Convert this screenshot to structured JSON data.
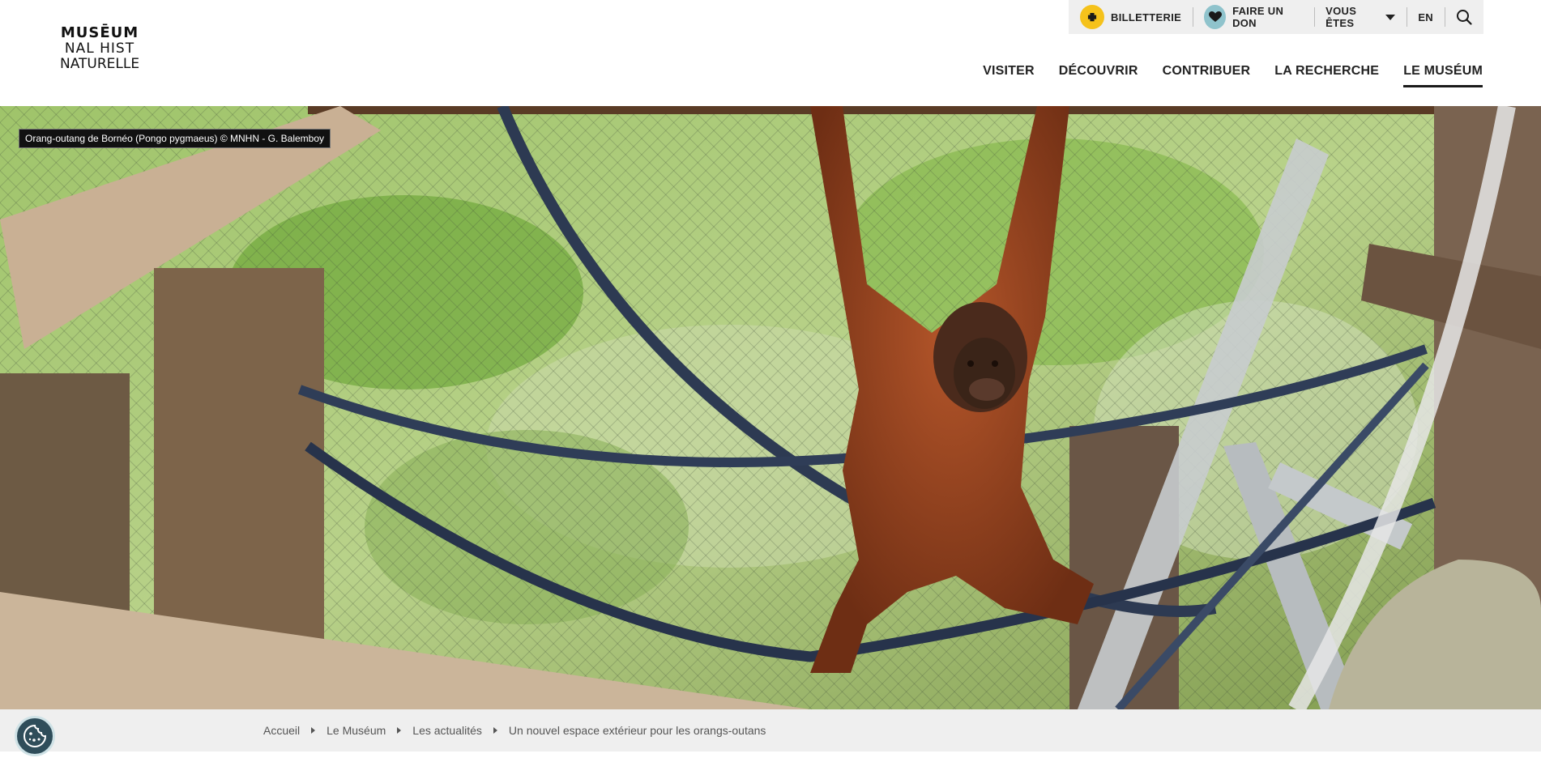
{
  "logo": {
    "line1": "MUSĒUM",
    "line2": "NAL HIST",
    "line3": "NATURELLE"
  },
  "topbar": {
    "ticket_label": "BILLETTERIE",
    "donate_label": "FAIRE UN DON",
    "profile_label": "VOUS ÊTES",
    "lang_label": "EN"
  },
  "nav": {
    "items": [
      {
        "label": "VISITER"
      },
      {
        "label": "DÉCOUVRIR"
      },
      {
        "label": "CONTRIBUER"
      },
      {
        "label": "LA RECHERCHE"
      },
      {
        "label": "LE MUSÉUM"
      }
    ],
    "active_index": 4
  },
  "hero": {
    "credit": "Orang-outang de Bornéo (Pongo pygmaeus) © MNHN - G. Balemboy"
  },
  "breadcrumb": {
    "items": [
      "Accueil",
      "Le Muséum",
      "Les actualités"
    ],
    "current": "Un nouvel espace extérieur pour les orangs-outans"
  },
  "colors": {
    "ticket_icon_bg": "#f5c21b",
    "donate_icon_bg": "#8fc3cc",
    "topbar_bg": "#efefef",
    "cookie_bg": "#2f4d5a"
  },
  "icons": {
    "ticket": "ticket-icon",
    "donate": "heart-icon",
    "search": "search-icon",
    "cookie": "cookie-icon"
  }
}
